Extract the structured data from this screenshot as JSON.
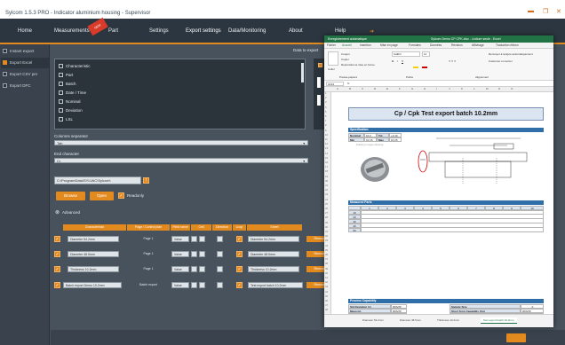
{
  "app": {
    "title": "Sylcom 1.5.3 PRO - Indicator aluminium housing - Supervisor"
  },
  "nav": {
    "items": [
      "Home",
      "Measurements",
      "Part",
      "Settings",
      "Export settings",
      "Data/Monitoring",
      "About",
      "Help"
    ],
    "flag": "NEW"
  },
  "sidebar": {
    "items": [
      {
        "label": "Instant export",
        "checked": false
      },
      {
        "label": "Export Excel",
        "checked": true
      },
      {
        "label": "Export CSV per",
        "checked": false
      },
      {
        "label": "Export DFC",
        "checked": false
      }
    ]
  },
  "data_to_export": {
    "title": "Data to export",
    "items": [
      "Characteristic",
      "Part",
      "Batch",
      "Date / Time",
      "Nominal",
      "Deviation",
      "LSL"
    ],
    "value_label": "Value"
  },
  "columns_separator": {
    "label": "Columns separator",
    "value": "Tab"
  },
  "end_character": {
    "label": "End character",
    "value": "Cr"
  },
  "path": {
    "value": "C:\\ProgramData\\SYLVAC\\Sylcom\\"
  },
  "buttons": {
    "browse": "Browse",
    "open": "Open",
    "readonly": "Readonly",
    "advanced": "Advanced"
  },
  "table": {
    "headers": [
      "Characteristic",
      "Page / Control plan",
      "Field name",
      "Cell",
      "Direction",
      "Loop",
      "Sheet"
    ],
    "rows": [
      {
        "char": "Diameter 54.2mm",
        "page": "Page 1",
        "field": "Value",
        "sheet": "Diameter 54.2mm",
        "remove": "Remove"
      },
      {
        "char": "Diameter 48.5mm",
        "page": "Page 1",
        "field": "Value",
        "sheet": "Diameter 48.5mm",
        "remove": "Remove"
      },
      {
        "char": "Thickness 10.2mm",
        "page": "Page 1",
        "field": "Value",
        "sheet": "Thickness 10.2mm",
        "remove": "Remove"
      },
      {
        "char": "Batch export Demo 10.2mm",
        "page": "Batch export",
        "field": "Value",
        "sheet": "Test export batch 10.2mm",
        "remove": "Remove"
      }
    ]
  },
  "excel": {
    "title_bar": "Enregistrement automatique",
    "file_name": "Sylcom Demo CP CPK.xlsx - Lecture seule - Excel",
    "tabs": [
      "Fichier",
      "Accueil",
      "Insertion",
      "Mise en page",
      "Formules",
      "Données",
      "Révision",
      "Affichage",
      "Traduction ribbon"
    ],
    "ribbon": {
      "paste": "Coller",
      "cut": "Couper",
      "copy": "Copier",
      "format": "Reproduire la mise en forme",
      "clipboard": "Presse-papiers",
      "font": "Calibri",
      "font_size": "11",
      "police": "Police",
      "alignment": "Alignement",
      "wrap": "Renvoyer à la ligne automatiquement",
      "merge": "Fusionner et centrer"
    },
    "cell_ref": "A134",
    "report_title": "Cp / Cpk Test export batch 10.2mm",
    "specification": {
      "title": "Specification",
      "rows": [
        [
          "Nominal",
          "10.2",
          "Tol.",
          "+0.10"
        ],
        [
          "Min",
          "10.15",
          "Max",
          "10.25"
        ]
      ],
      "drawing_label": "Drawing / Image reference"
    },
    "measured_parts": {
      "title": "Measured Parts",
      "cols": [
        "1",
        "2",
        "3",
        "4",
        "5",
        "6",
        "7",
        "8",
        "9",
        "10"
      ],
      "rows": [
        "10",
        "20",
        "30",
        "40",
        "50"
      ]
    },
    "process_capability": {
      "title": "Process Capability",
      "left": [
        [
          "Std Deviation (s)",
          "#DIV/0!"
        ],
        [
          "Mean (μ)",
          "#DIV/0!"
        ],
        [
          "Upper Control Limit (UCL)",
          "#DIV/0!"
        ],
        [
          "Lower Control Limit (LCL)",
          "#DIV/0!"
        ]
      ],
      "right": [
        [
          "Sample Size",
          "0"
        ],
        [
          "Short Term Capability (Cp)",
          "#DIV/0!"
        ],
        [
          "Short Term Centered Capability (Cpk)",
          "#DIV/0!"
        ]
      ]
    },
    "sheet_tabs": [
      "Diameter 54.2mm",
      "Diameter 48.5mm",
      "Thickness 10.2mm",
      "Test export batch 10.2mm"
    ]
  },
  "colors": {
    "accent": "#e38a1f",
    "excel_green": "#217346",
    "bg": "#47525d",
    "nav_bg": "#2c3640"
  }
}
